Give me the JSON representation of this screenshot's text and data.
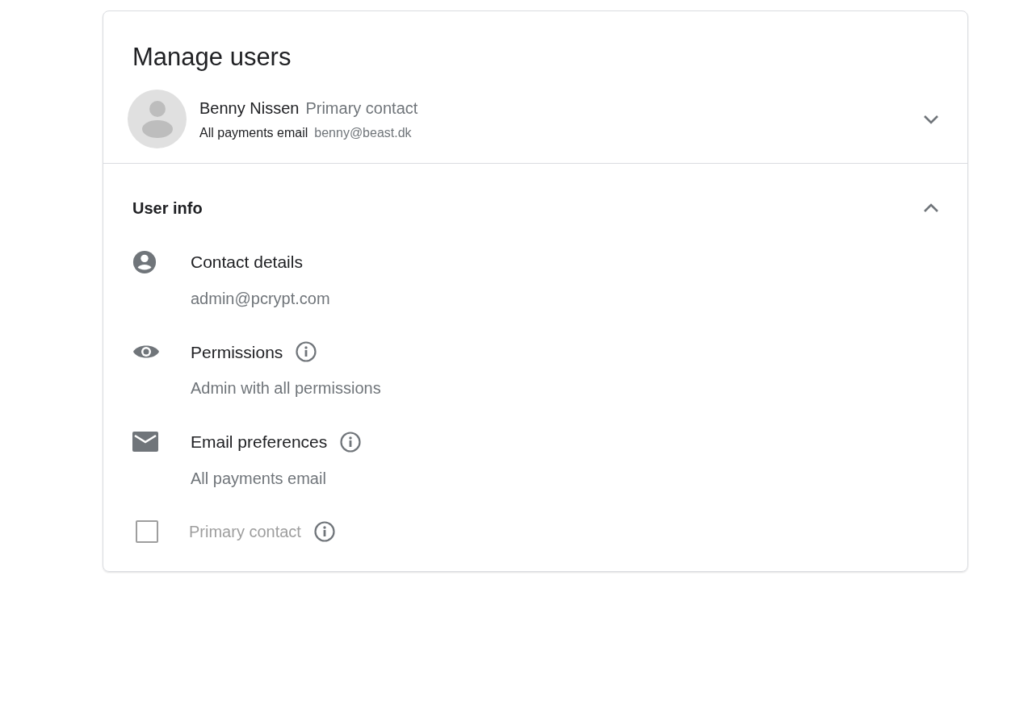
{
  "title": "Manage users",
  "user": {
    "name": "Benny Nissen",
    "role": "Primary contact",
    "email_label": "All payments email",
    "email": "benny@beast.dk",
    "expanded": false
  },
  "section": {
    "title": "User info",
    "expanded": true,
    "items": [
      {
        "kind": "person",
        "label": "Contact details",
        "info": false,
        "value": "admin@pcrypt.com"
      },
      {
        "kind": "eye",
        "label": "Permissions",
        "info": true,
        "value": "Admin with all permissions"
      },
      {
        "kind": "mail",
        "label": "Email preferences",
        "info": true,
        "value": "All payments email"
      }
    ],
    "checkbox": {
      "label": "Primary contact",
      "checked": false,
      "disabled": true,
      "info": true
    }
  }
}
